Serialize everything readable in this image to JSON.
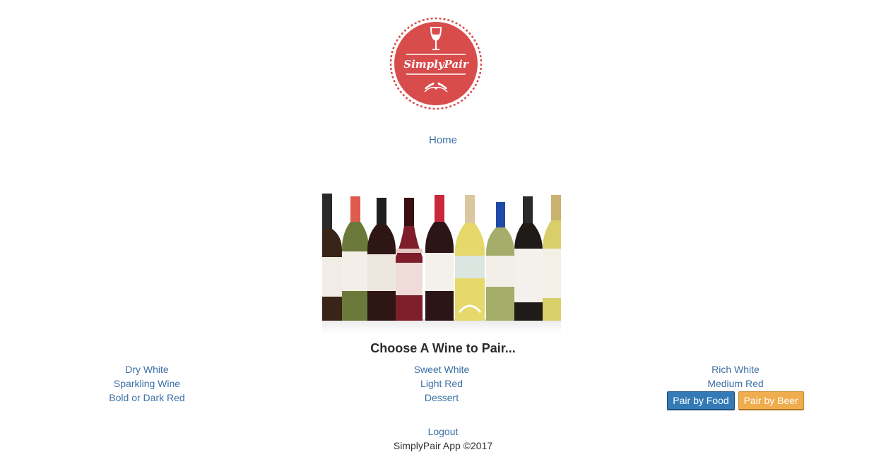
{
  "logo": {
    "text": "SimplyPair",
    "color": "#d84c4c",
    "icons": [
      "wine-glass-icon",
      "wheat-icon"
    ]
  },
  "nav": {
    "home": "Home"
  },
  "hero": {
    "icon": "wine-bottles-image"
  },
  "main": {
    "heading": "Choose A Wine to Pair...",
    "columns": {
      "left": [
        "Dry White",
        "Sparkling Wine",
        "Bold or Dark Red"
      ],
      "middle": [
        "Sweet White",
        "Light Red",
        "Dessert"
      ],
      "right": [
        "Rich White",
        "Medium Red"
      ]
    },
    "buttons": {
      "food": "Pair by Food",
      "beer": "Pair by Beer"
    }
  },
  "footer": {
    "logout": "Logout",
    "copyright": "SimplyPair App ©2017"
  },
  "colors": {
    "link": "#3d6fa6",
    "food_button": "#337ab7",
    "beer_button": "#f0ad4e"
  }
}
